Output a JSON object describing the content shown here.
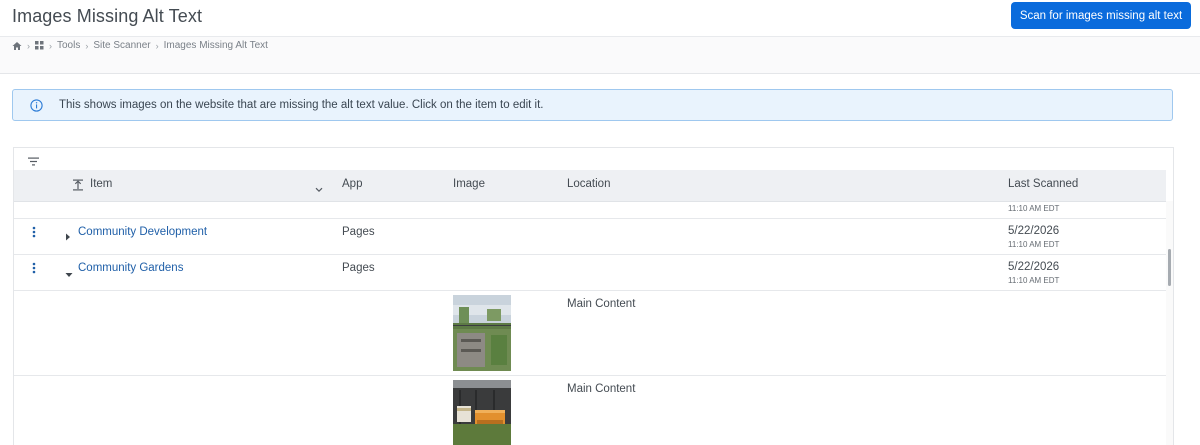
{
  "header": {
    "title": "Images Missing Alt Text",
    "scan_button": "Scan for images missing alt text"
  },
  "breadcrumb": {
    "icons": [
      "home-icon",
      "apps-grid-icon"
    ],
    "items": [
      "Tools",
      "Site Scanner",
      "Images Missing Alt Text"
    ]
  },
  "info": {
    "icon": "info-icon",
    "text": "This shows images on the website that are missing the alt text value. Click on the item to edit it."
  },
  "grid": {
    "filter_icon": "filter-icon",
    "columns": {
      "item": "Item",
      "app": "App",
      "image": "Image",
      "location": "Location",
      "last_scanned": "Last Scanned"
    },
    "rows": [
      {
        "time": "11:10 AM EDT"
      },
      {
        "item": "Community Development",
        "expanded": false,
        "app": "Pages",
        "date": "5/22/2026",
        "time": "11:10 AM EDT"
      },
      {
        "item": "Community Gardens",
        "expanded": true,
        "app": "Pages",
        "date": "5/22/2026",
        "time": "11:10 AM EDT"
      },
      {
        "location": "Main Content",
        "image": "garden-photo"
      },
      {
        "location": "Main Content",
        "image": "beehive-photo"
      }
    ]
  },
  "colors": {
    "accent": "#0a6bdc",
    "link": "#1f5fa8",
    "info_bg": "#e9f3fd",
    "info_border": "#9fc8ef"
  }
}
